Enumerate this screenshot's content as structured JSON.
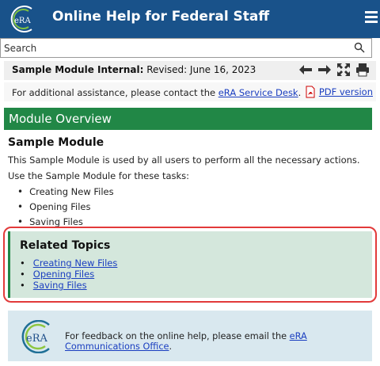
{
  "header": {
    "title": "Online Help for Federal Staff",
    "logo_text": "eRA",
    "background": "#19528a"
  },
  "search": {
    "placeholder": "Search"
  },
  "module_bar": {
    "label": "Sample Module Internal:",
    "revised": "Revised: June 16, 2023"
  },
  "assist": {
    "text": "For additional assistance, please contact the ",
    "link": "eRA Service Desk",
    "suffix": ".",
    "pdf_link": "PDF version"
  },
  "overview": {
    "title": "Module Overview",
    "color": "#218746"
  },
  "content": {
    "heading": "Sample Module",
    "intro": "This Sample Module is used by all users to perform all the necessary actions.",
    "tasks_intro": "Use the Sample Module for these tasks:",
    "tasks": [
      "Creating New Files",
      "Opening Files",
      "Saving Files"
    ]
  },
  "related": {
    "title": "Related Topics",
    "links": [
      "Creating New Files",
      "Opening Files",
      "Saving Files"
    ]
  },
  "feedback": {
    "logo_text": "eRA",
    "text": "For feedback on the online help, please email the ",
    "link": "eRA Communications Office",
    "suffix": "."
  }
}
